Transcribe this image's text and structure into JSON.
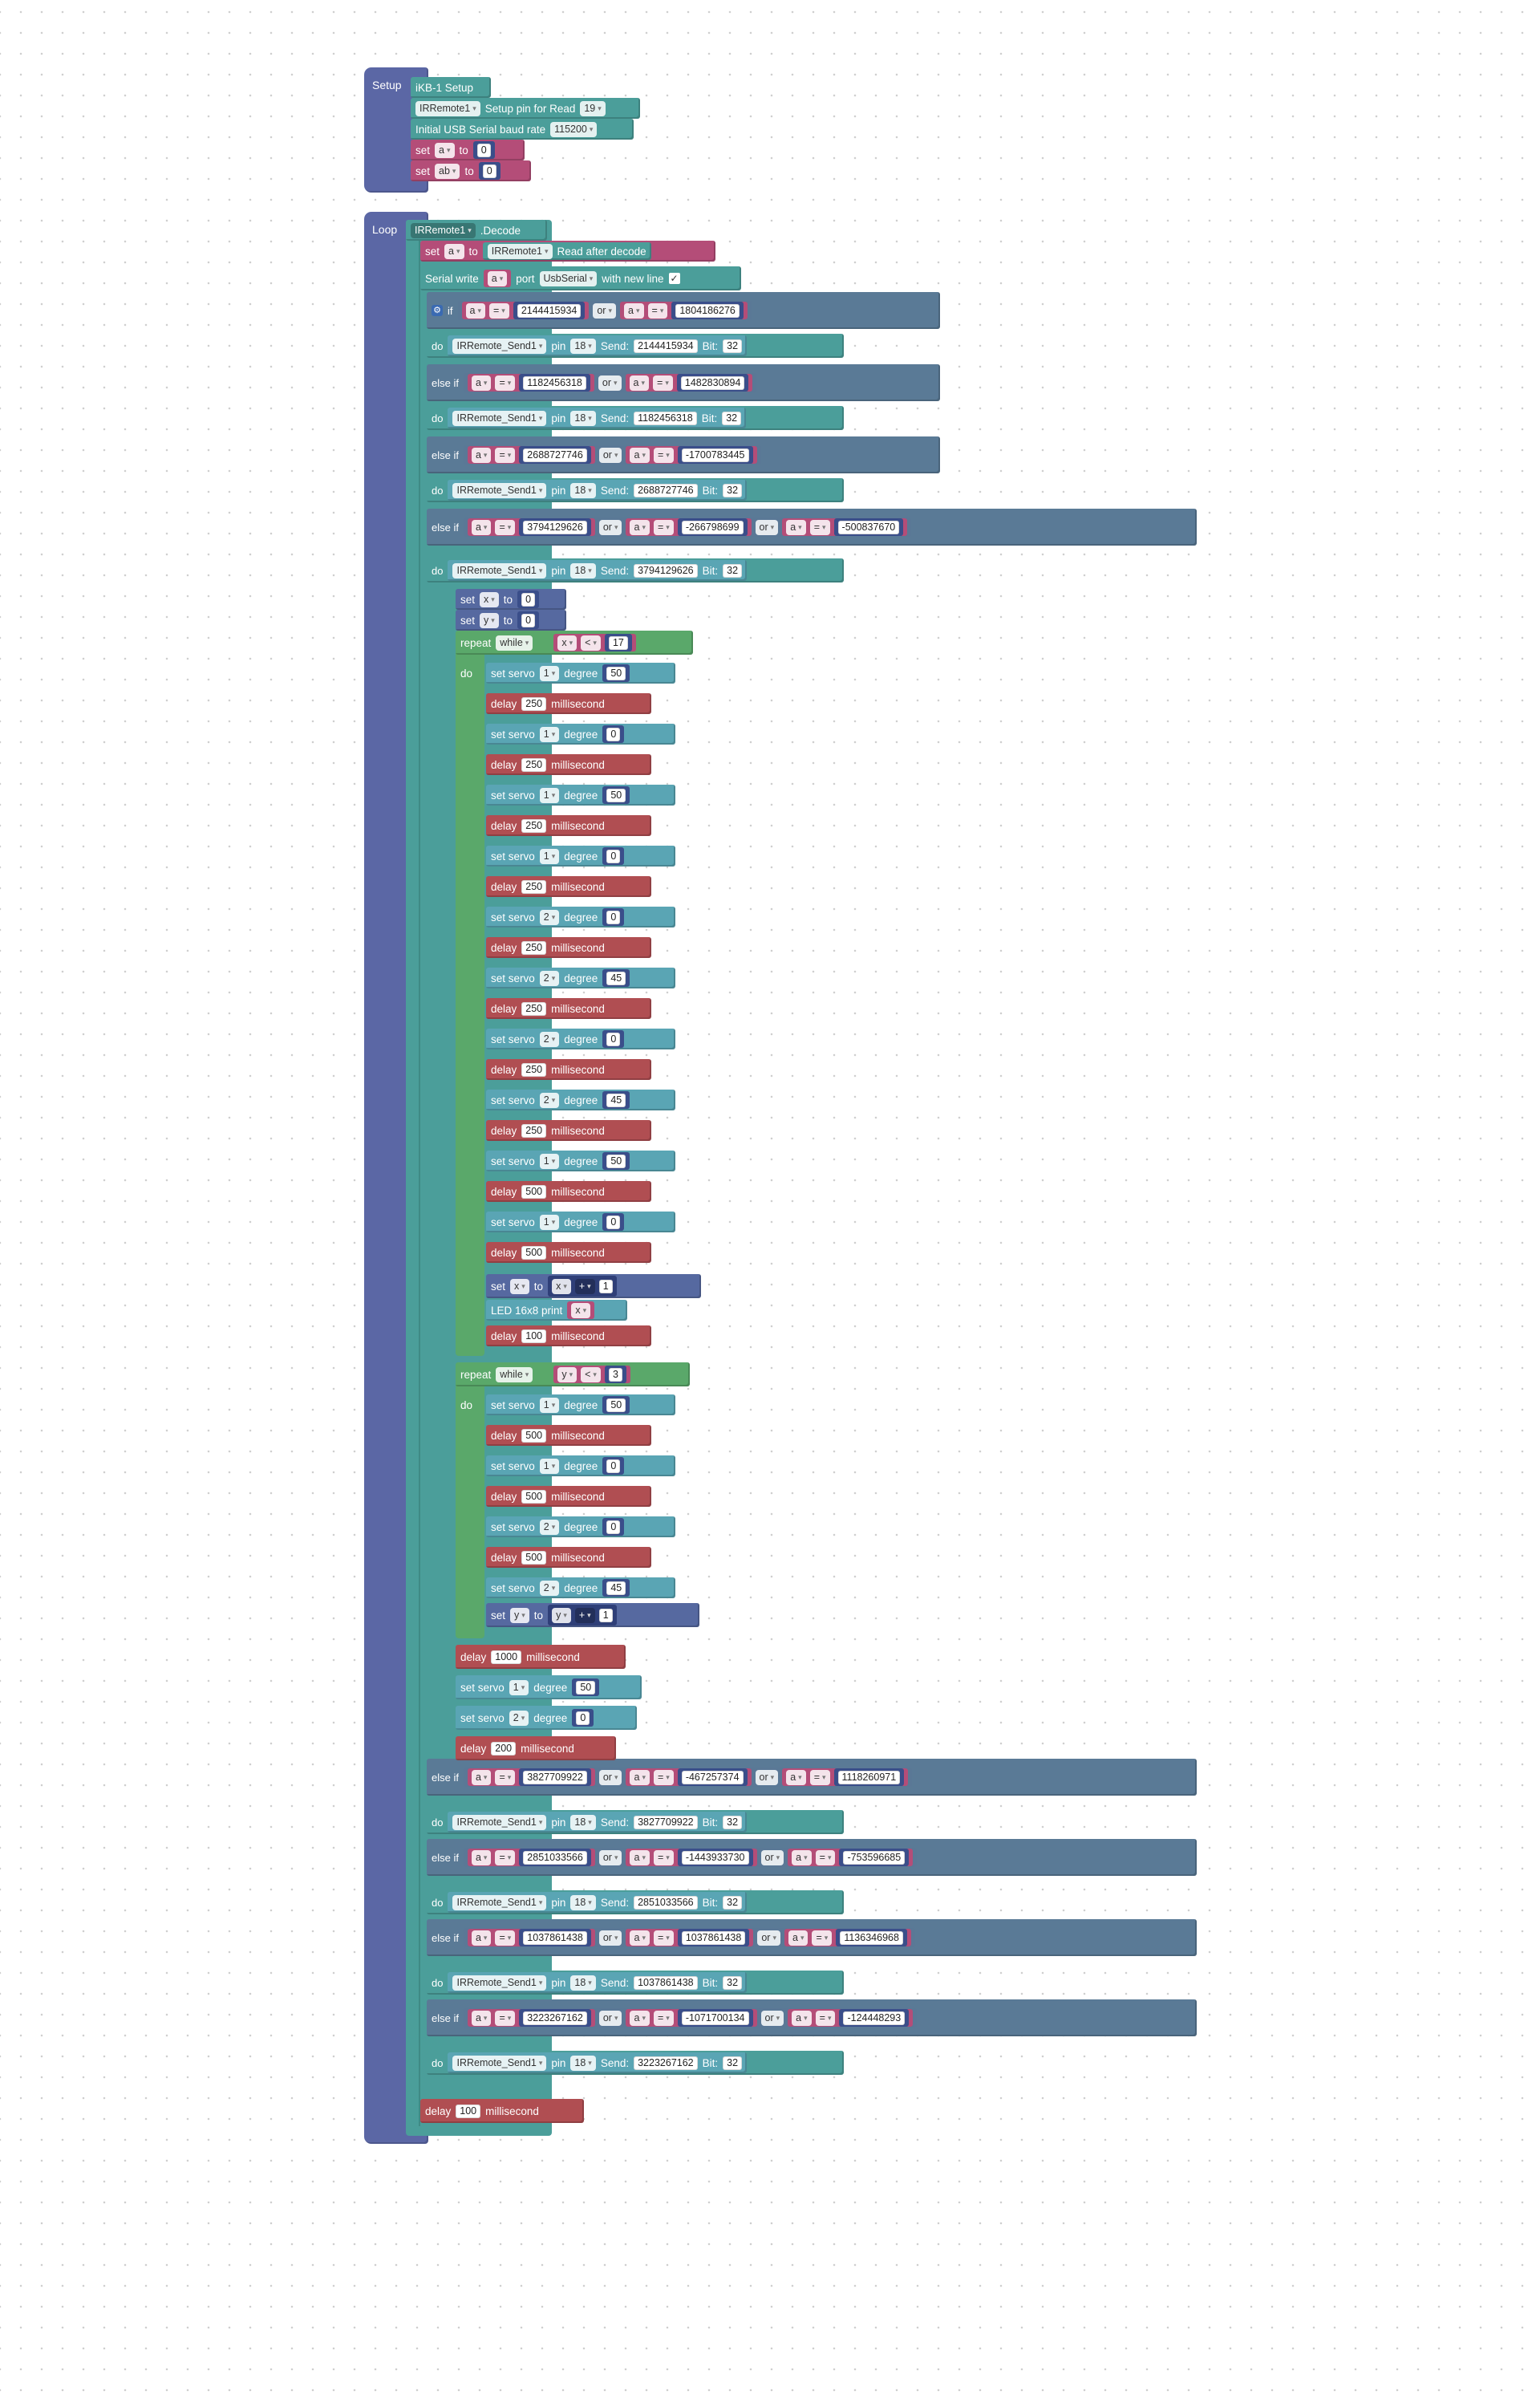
{
  "setup": {
    "hat_label": "Setup",
    "board": "iKB-1 Setup",
    "ir_device": "IRRemote1",
    "ir_setup_text": "Setup pin for Read",
    "ir_pin": "19",
    "serial_text": "Initial USB Serial baud rate",
    "baud": "115200",
    "set_kw": "set",
    "to_kw": "to",
    "var_a": "a",
    "var_ab": "ab",
    "zero": "0"
  },
  "loop": {
    "hat_label": "Loop",
    "decode_device": "IRRemote1",
    "decode_text": ".Decode",
    "set_a_text": "set",
    "set_a_var": "a",
    "to_kw": "to",
    "read_device": "IRRemote1",
    "read_text": "Read after decode",
    "serial_write": "Serial write",
    "serial_var": "a",
    "port_text": "port",
    "port": "UsbSerial",
    "newline_text": "with new line",
    "check": "✓",
    "if_kw": "if",
    "else_if_kw": "else if",
    "do_kw": "do",
    "or_kw": "or",
    "eq": "=",
    "var": "a",
    "send_device": "IRRemote_Send1",
    "pin_kw": "pin",
    "pin": "18",
    "send_kw": "Send:",
    "bit_kw": "Bit:",
    "bits": "32",
    "branches": [
      {
        "v1": "2144415934",
        "v2": "1804186276",
        "send": "2144415934"
      },
      {
        "v1": "1182456318",
        "v2": "1482830894",
        "send": "1182456318"
      },
      {
        "v1": "2688727746",
        "v2": "-1700783445",
        "send": "2688727746"
      },
      {
        "v1": "3794129626",
        "v2": "-266798699",
        "v3": "-500837670",
        "send": "3794129626"
      },
      {
        "v1": "3827709922",
        "v2": "-467257374",
        "v3": "1118260971",
        "send": "3827709922"
      },
      {
        "v1": "2851033566",
        "v2": "-1443933730",
        "v3": "-753596685",
        "send": "2851033566"
      },
      {
        "v1": "1037861438",
        "v2": "1037861438",
        "v3": "1136346968",
        "send": "1037861438"
      },
      {
        "v1": "3223267162",
        "v2": "-1071700134",
        "v3": "-124448293",
        "send": "3223267162"
      }
    ],
    "set_x": {
      "kw": "set",
      "var": "x",
      "to": "to",
      "val": "0"
    },
    "set_y": {
      "kw": "set",
      "var": "y",
      "to": "to",
      "val": "0"
    },
    "repeat_kw": "repeat",
    "while_kw": "while",
    "lt": "<",
    "plus": "+",
    "repeat1": {
      "var": "x",
      "limit": "17"
    },
    "repeat2": {
      "var": "y",
      "limit": "3"
    },
    "servo_kw": "set servo",
    "degree_kw": "degree",
    "delay_kw": "delay",
    "ms_kw": "millisecond",
    "led_text": "LED 16x8 print",
    "one": "1",
    "loop1_steps": [
      {
        "t": "servo",
        "n": "1",
        "v": "50"
      },
      {
        "t": "delay",
        "v": "250"
      },
      {
        "t": "servo",
        "n": "1",
        "v": "0"
      },
      {
        "t": "delay",
        "v": "250"
      },
      {
        "t": "servo",
        "n": "1",
        "v": "50"
      },
      {
        "t": "delay",
        "v": "250"
      },
      {
        "t": "servo",
        "n": "1",
        "v": "0"
      },
      {
        "t": "delay",
        "v": "250"
      },
      {
        "t": "servo",
        "n": "2",
        "v": "0"
      },
      {
        "t": "delay",
        "v": "250"
      },
      {
        "t": "servo",
        "n": "2",
        "v": "45"
      },
      {
        "t": "delay",
        "v": "250"
      },
      {
        "t": "servo",
        "n": "2",
        "v": "0"
      },
      {
        "t": "delay",
        "v": "250"
      },
      {
        "t": "servo",
        "n": "2",
        "v": "45"
      },
      {
        "t": "delay",
        "v": "250"
      },
      {
        "t": "servo",
        "n": "1",
        "v": "50"
      },
      {
        "t": "delay",
        "v": "500"
      },
      {
        "t": "servo",
        "n": "1",
        "v": "0"
      },
      {
        "t": "delay",
        "v": "500"
      }
    ],
    "loop1_tail_delay": "100",
    "loop2_steps": [
      {
        "t": "servo",
        "n": "1",
        "v": "50"
      },
      {
        "t": "delay",
        "v": "500"
      },
      {
        "t": "servo",
        "n": "1",
        "v": "0"
      },
      {
        "t": "delay",
        "v": "500"
      },
      {
        "t": "servo",
        "n": "2",
        "v": "0"
      },
      {
        "t": "delay",
        "v": "500"
      },
      {
        "t": "servo",
        "n": "2",
        "v": "45"
      }
    ],
    "after_delay1": "1000",
    "after_servo1": {
      "n": "1",
      "v": "50"
    },
    "after_servo2": {
      "n": "2",
      "v": "0"
    },
    "after_delay2": "200",
    "final_delay": "100"
  }
}
